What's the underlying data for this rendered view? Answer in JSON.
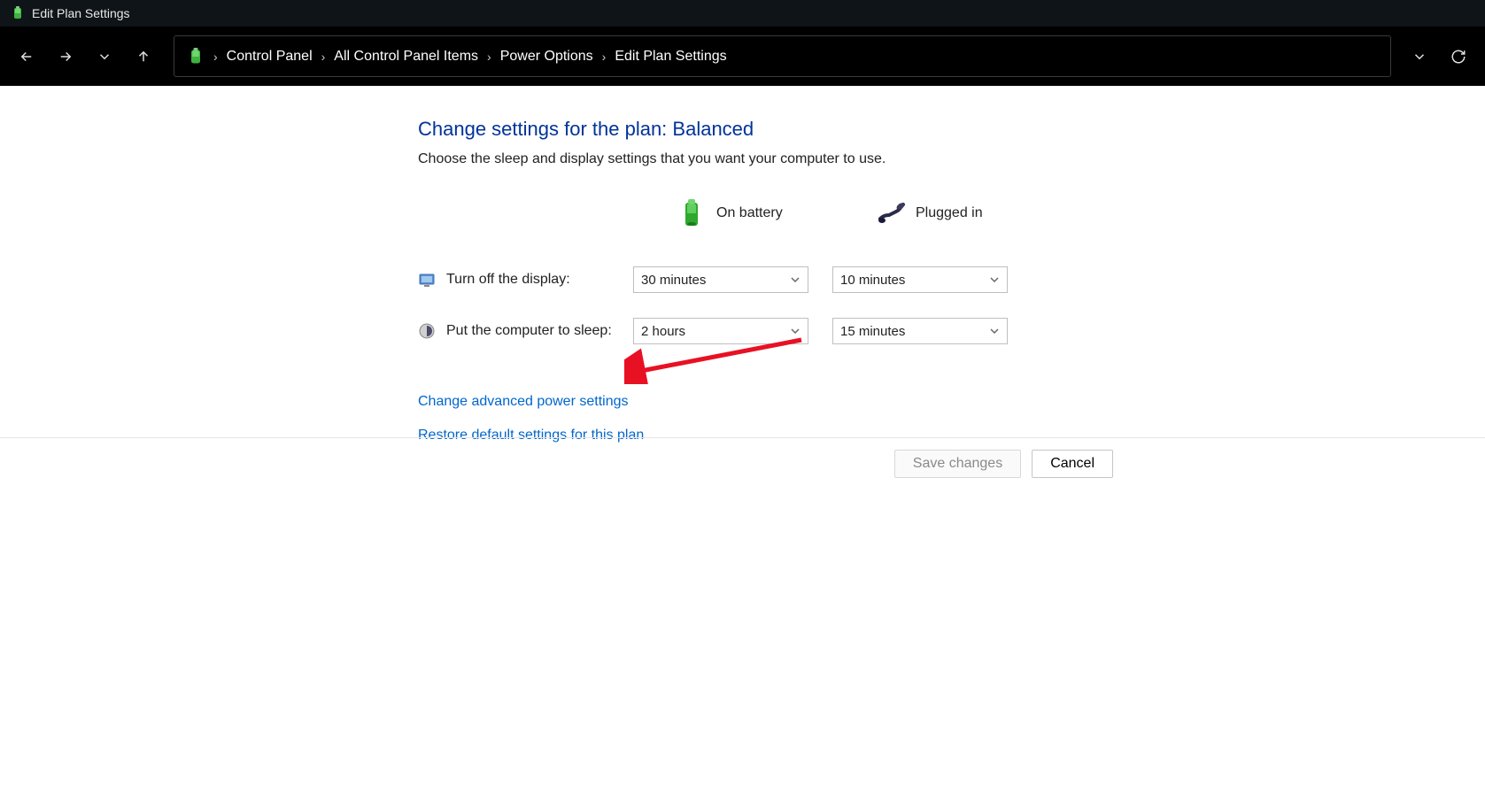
{
  "titlebar": {
    "title": "Edit Plan Settings"
  },
  "breadcrumb": {
    "items": [
      "Control Panel",
      "All Control Panel Items",
      "Power Options",
      "Edit Plan Settings"
    ]
  },
  "page": {
    "heading": "Change settings for the plan: Balanced",
    "sub": "Choose the sleep and display settings that you want your computer to use."
  },
  "columns": {
    "battery": "On battery",
    "plugged": "Plugged in"
  },
  "rows": {
    "display": {
      "label": "Turn off the display:",
      "battery": "30 minutes",
      "plugged": "10 minutes"
    },
    "sleep": {
      "label": "Put the computer to sleep:",
      "battery": "2 hours",
      "plugged": "15 minutes"
    }
  },
  "links": {
    "advanced": "Change advanced power settings",
    "restore": "Restore default settings for this plan"
  },
  "buttons": {
    "save": "Save changes",
    "cancel": "Cancel"
  }
}
